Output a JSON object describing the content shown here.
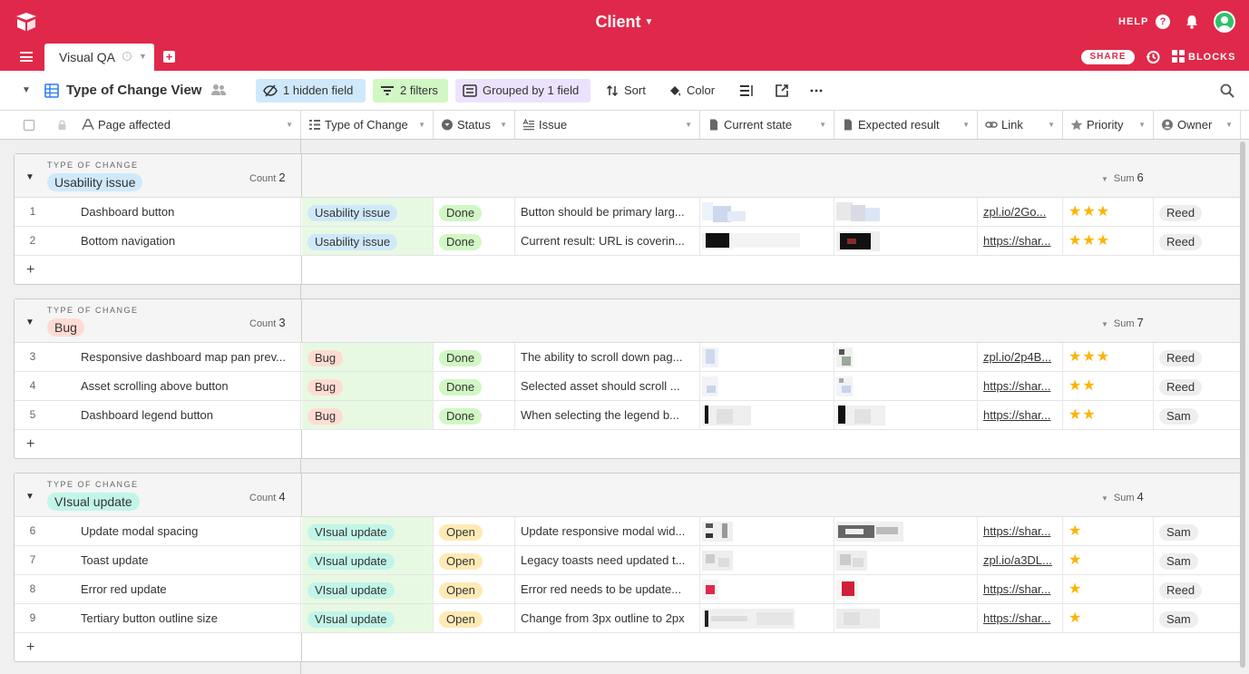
{
  "app": {
    "title": "Client",
    "help_label": "HELP",
    "share_label": "SHARE",
    "blocks_label": "BLOCKS",
    "brand_color": "#e0294a"
  },
  "tabs": [
    {
      "label": "Visual QA"
    }
  ],
  "toolbar": {
    "view_name": "Type of Change View",
    "hidden_field": "1 hidden field",
    "filters": "2 filters",
    "grouped": "Grouped by 1 field",
    "sort": "Sort",
    "color": "Color"
  },
  "columns": [
    {
      "label": "Page affected",
      "icon": "text-icon"
    },
    {
      "label": "Type of Change",
      "icon": "single-select-icon"
    },
    {
      "label": "Status",
      "icon": "status-icon"
    },
    {
      "label": "Issue",
      "icon": "long-text-icon"
    },
    {
      "label": "Current state",
      "icon": "attachment-icon"
    },
    {
      "label": "Expected result",
      "icon": "attachment-icon"
    },
    {
      "label": "Link",
      "icon": "link-icon"
    },
    {
      "label": "Priority",
      "icon": "star-icon"
    },
    {
      "label": "Owner",
      "icon": "user-icon"
    }
  ],
  "group_field_label": "TYPE OF CHANGE",
  "count_label": "Count",
  "sum_label": "Sum",
  "add_row_symbol": "+",
  "groups": [
    {
      "name": "Usability issue",
      "count": "2",
      "sum": "6",
      "rows": [
        {
          "num": "1",
          "page": "Dashboard button",
          "type": "Usability issue",
          "status": "Done",
          "issue": "Button should be primary larg...",
          "link": "zpl.io/2Go...",
          "priority": 3,
          "owner": "Reed"
        },
        {
          "num": "2",
          "page": "Bottom navigation",
          "type": "Usability issue",
          "status": "Done",
          "issue": "Current result: URL is coverin...",
          "link": "https://shar...",
          "priority": 3,
          "owner": "Reed"
        }
      ]
    },
    {
      "name": "Bug",
      "count": "3",
      "sum": "7",
      "rows": [
        {
          "num": "3",
          "page": "Responsive dashboard map pan prev...",
          "type": "Bug",
          "status": "Done",
          "issue": "The ability to scroll down pag...",
          "link": "zpl.io/2p4B...",
          "priority": 3,
          "owner": "Reed"
        },
        {
          "num": "4",
          "page": "Asset scrolling above button",
          "type": "Bug",
          "status": "Done",
          "issue": "Selected asset should scroll ...",
          "link": "https://shar...",
          "priority": 2,
          "owner": "Reed"
        },
        {
          "num": "5",
          "page": "Dashboard legend button",
          "type": "Bug",
          "status": "Done",
          "issue": "When selecting the legend b...",
          "link": "https://shar...",
          "priority": 2,
          "owner": "Sam"
        }
      ]
    },
    {
      "name": "VIsual update",
      "count": "4",
      "sum": "4",
      "rows": [
        {
          "num": "6",
          "page": "Update modal spacing",
          "type": "VIsual update",
          "status": "Open",
          "issue": "Update responsive modal wid...",
          "link": "https://shar...",
          "priority": 1,
          "owner": "Sam"
        },
        {
          "num": "7",
          "page": "Toast update",
          "type": "VIsual update",
          "status": "Open",
          "issue": "Legacy toasts need updated t...",
          "link": "zpl.io/a3DL...",
          "priority": 1,
          "owner": "Sam"
        },
        {
          "num": "8",
          "page": "Error red update",
          "type": "VIsual update",
          "status": "Open",
          "issue": "Error red needs to be update...",
          "link": "https://shar...",
          "priority": 1,
          "owner": "Reed"
        },
        {
          "num": "9",
          "page": "Tertiary button outline size",
          "type": "VIsual update",
          "status": "Open",
          "issue": "Change from 3px outline to 2px",
          "link": "https://shar...",
          "priority": 1,
          "owner": "Sam"
        }
      ]
    }
  ]
}
